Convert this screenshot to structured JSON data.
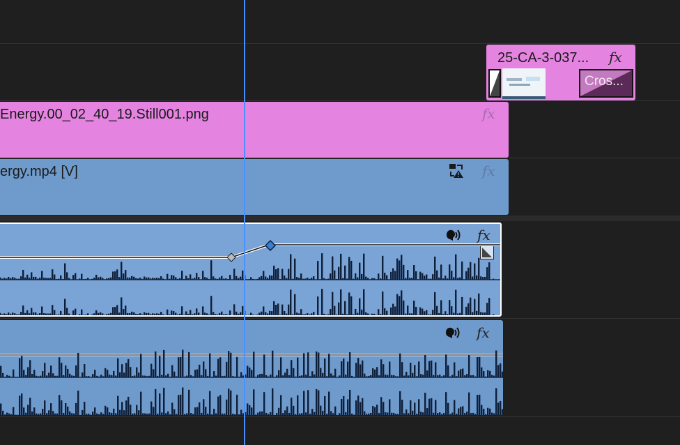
{
  "timeline": {
    "colors": {
      "background": "#1f1f1f",
      "video_clip": "#e583e1",
      "audio_clip": "#6f9bcc",
      "playhead": "#4a90ff",
      "waveform": "#0e1f3a"
    },
    "clips": {
      "top_clip": {
        "name": "25-CA-3-037...",
        "fx_label": "fx",
        "transition_label": "Cros..."
      },
      "still_clip": {
        "name": "Energy.00_02_40_19.Still001.png",
        "fx_label": "fx"
      },
      "video_clip": {
        "name": "ergy.mp4 [V]",
        "fx_label": "fx",
        "badge_icon": "replace-warning-icon"
      },
      "audio_clip_1": {
        "fx_label": "fx",
        "voice_icon": "speaker-voice-icon",
        "keyframe_icon": "keyframe-icon"
      },
      "audio_clip_2": {
        "fx_label": "fx",
        "voice_icon": "speaker-voice-icon"
      }
    }
  }
}
